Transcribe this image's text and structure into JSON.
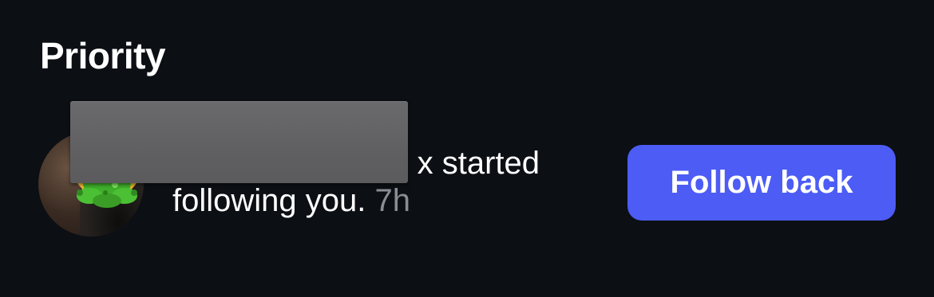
{
  "section": {
    "title": "Priority"
  },
  "notification": {
    "text_line1": "x started",
    "text_line2": "following you.",
    "time": "7h",
    "action_label": "Follow back",
    "avatar_icon": "user-avatar",
    "sticker_icon": "nauseated-face-emoji",
    "redaction": "redacted-username-box"
  },
  "colors": {
    "background": "#0c0f14",
    "button": "#4c5cf5",
    "text": "#ffffff",
    "muted_text": "#8a8d93",
    "redaction": "#646467"
  }
}
